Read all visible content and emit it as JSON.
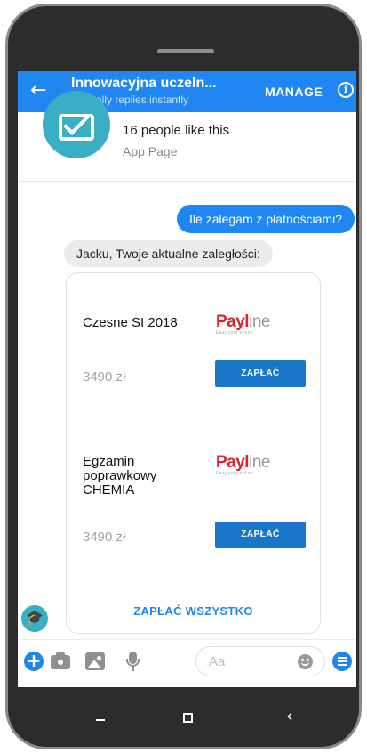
{
  "header": {
    "title": "Innowacyjna uczeln...",
    "subtitle": "Typically replies instantly",
    "manage_label": "MANAGE",
    "back_icon": "arrow-left-icon",
    "info_icon": "info-icon",
    "info_glyph": "i",
    "back_glyph": "←",
    "color": "#1f86f2"
  },
  "page_card": {
    "likes": "16 people like this",
    "type": "App Page",
    "avatar_icon": "envelope-icon"
  },
  "messages": {
    "outgoing": "Ile zalegam z płatnościami?",
    "incoming": "Jacku, Twoje aktualne zaległości:"
  },
  "payments": {
    "items": [
      {
        "name": "Czesne SI 2018",
        "amount": "3490 zł",
        "button": "ZAPŁAĆ",
        "logo_main": "Payl",
        "logo_tail": "ine",
        "logo_tag": "Easy your online"
      },
      {
        "name": "Egzamin poprawkowy CHEMIA",
        "amount": "3490 zł",
        "button": "ZAPŁAĆ",
        "logo_main": "Payl",
        "logo_tail": "ine",
        "logo_tag": "Easy your online"
      }
    ],
    "pay_all": "ZAPŁAĆ WSZYSTKO"
  },
  "composer": {
    "placeholder": "Aa",
    "plus_glyph": "+",
    "icons": [
      "plus-icon",
      "camera-icon",
      "image-icon",
      "microphone-icon",
      "emoji-icon",
      "menu-icon"
    ]
  },
  "navbar": {
    "recent_glyph": "‹",
    "icons": [
      "nav-back-icon",
      "nav-home-icon",
      "nav-recent-icon"
    ]
  },
  "bot_avatar_glyph": "🎓"
}
